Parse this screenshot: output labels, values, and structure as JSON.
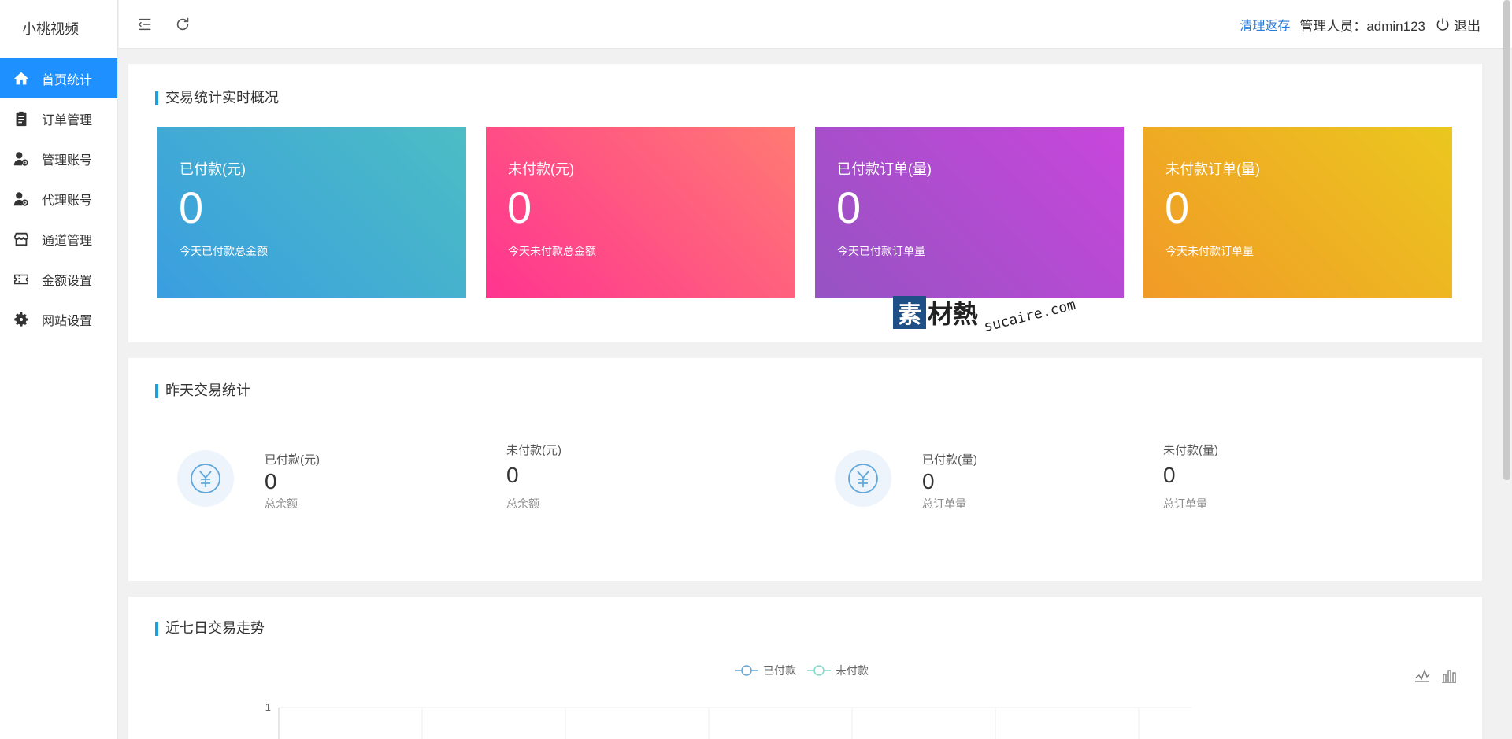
{
  "app": {
    "title": "小桃视频"
  },
  "sidebar": {
    "items": [
      {
        "label": "首页统计",
        "icon": "home-icon",
        "active": true
      },
      {
        "label": "订单管理",
        "icon": "clipboard-icon",
        "active": false
      },
      {
        "label": "管理账号",
        "icon": "user-gear-icon",
        "active": false
      },
      {
        "label": "代理账号",
        "icon": "user-gear-icon",
        "active": false
      },
      {
        "label": "通道管理",
        "icon": "store-icon",
        "active": false
      },
      {
        "label": "金额设置",
        "icon": "ticket-icon",
        "active": false
      },
      {
        "label": "网站设置",
        "icon": "gear-icon",
        "active": false
      }
    ]
  },
  "header": {
    "clear_cache": "清理返存",
    "admin_label": "管理人员：admin123",
    "logout": "退出"
  },
  "realtime": {
    "title": "交易统计实时概况",
    "cards": [
      {
        "label": "已付款(元)",
        "value": "0",
        "desc": "今天已付款总金额"
      },
      {
        "label": "未付款(元)",
        "value": "0",
        "desc": "今天未付款总金额"
      },
      {
        "label": "已付款订单(量)",
        "value": "0",
        "desc": "今天已付款订单量"
      },
      {
        "label": "未付款订单(量)",
        "value": "0",
        "desc": "今天未付款订单量"
      }
    ]
  },
  "watermark": {
    "brand": "素材熱",
    "logo_char": "素",
    "rest": "材熱",
    "url": "sucaire.com"
  },
  "yesterday": {
    "title": "昨天交易统计",
    "stats": [
      {
        "label": "已付款(元)",
        "value": "0",
        "desc": "总余额"
      },
      {
        "label": "未付款(元)",
        "value": "0",
        "desc": "总余额"
      },
      {
        "label": "已付款(量)",
        "value": "0",
        "desc": "总订单量"
      },
      {
        "label": "未付款(量)",
        "value": "0",
        "desc": "总订单量"
      }
    ]
  },
  "trend": {
    "title": "近七日交易走势",
    "legend": [
      {
        "name": "已付款",
        "color": "#5fa8dc"
      },
      {
        "name": "未付款",
        "color": "#7fdcc8"
      }
    ]
  },
  "chart_data": {
    "type": "line",
    "series": [
      {
        "name": "已付款",
        "values": []
      },
      {
        "name": "未付款",
        "values": []
      }
    ],
    "y_ticks": [
      "1"
    ],
    "grid": true,
    "legend_position": "top-center"
  },
  "colors": {
    "accent": "#1e90ff",
    "title_bar": "#1aa0e0"
  }
}
